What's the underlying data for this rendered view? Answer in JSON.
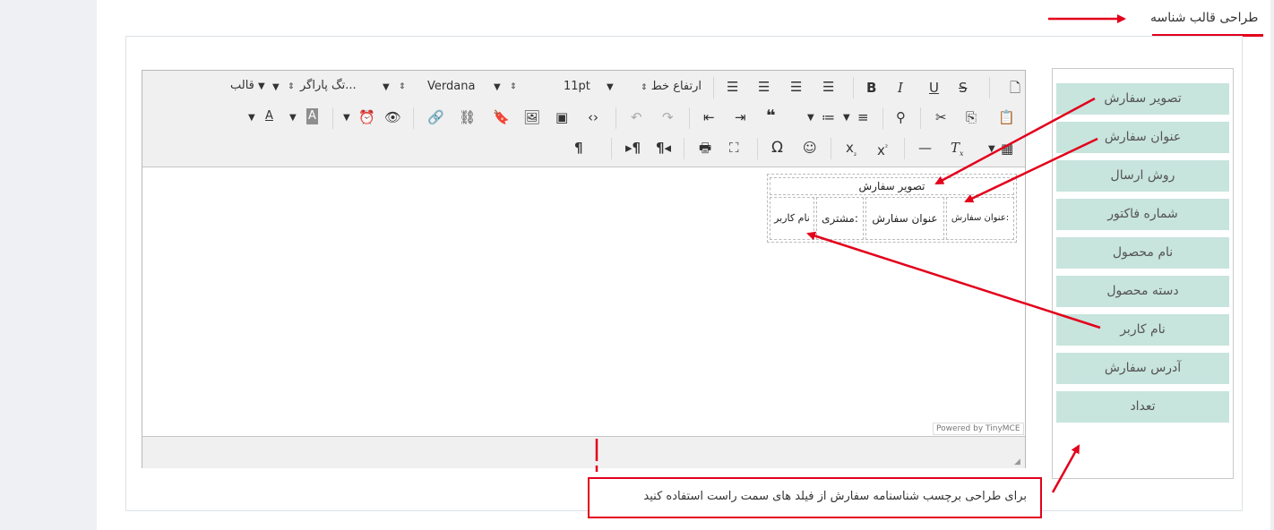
{
  "page": {
    "title": "طراحی قالب شناسه"
  },
  "toolbar": {
    "row1": {
      "format": "قالب",
      "paragraph_tag": "تگ پاراگر...",
      "font_family": "Verdana",
      "font_size": "11pt",
      "line_height": "ارتفاع خط"
    }
  },
  "label_preview": {
    "top_cell": "تصویر سفارش",
    "cells": [
      "عنوان سفارش:",
      "عنوان سفارش",
      "مشتری:",
      "نام کاربر"
    ]
  },
  "editor": {
    "powered_by": "Powered by TinyMCE"
  },
  "fields": [
    "تصویر سفارش",
    "عنوان سفارش",
    "روش ارسال",
    "شماره فاکتور",
    "نام محصول",
    "دسته محصول",
    "نام کاربر",
    "آدرس سفارش",
    "تعداد"
  ],
  "note": {
    "text": "برای طراحی برچسب شناسنامه سفارش از فیلد های سمت راست استفاده کنید"
  },
  "colors": {
    "accent": "#e3001b",
    "field_bg": "#c7e4dd",
    "toolbar_bg": "#f0f0f0"
  },
  "icons": [
    "new-document-icon",
    "strikethrough-icon",
    "underline-icon",
    "italic-icon",
    "bold-icon",
    "justify-icon",
    "align-right-icon",
    "align-center-icon",
    "align-left-icon",
    "paste-icon",
    "copy-icon",
    "cut-icon",
    "find-icon",
    "numbered-list-icon",
    "bullet-list-icon",
    "blockquote-icon",
    "indent-icon",
    "outdent-icon",
    "redo-icon",
    "undo-icon",
    "code-icon",
    "media-icon",
    "image-icon",
    "anchor-icon",
    "unlink-icon",
    "link-icon",
    "preview-icon",
    "clock-icon",
    "background-color-icon",
    "text-color-icon",
    "table-icon",
    "clear-format-icon",
    "horizontal-rule-icon",
    "superscript-icon",
    "subscript-icon",
    "emoticon-icon",
    "special-char-icon",
    "fullscreen-icon",
    "print-icon",
    "rtl-icon",
    "ltr-icon",
    "show-blocks-icon"
  ]
}
